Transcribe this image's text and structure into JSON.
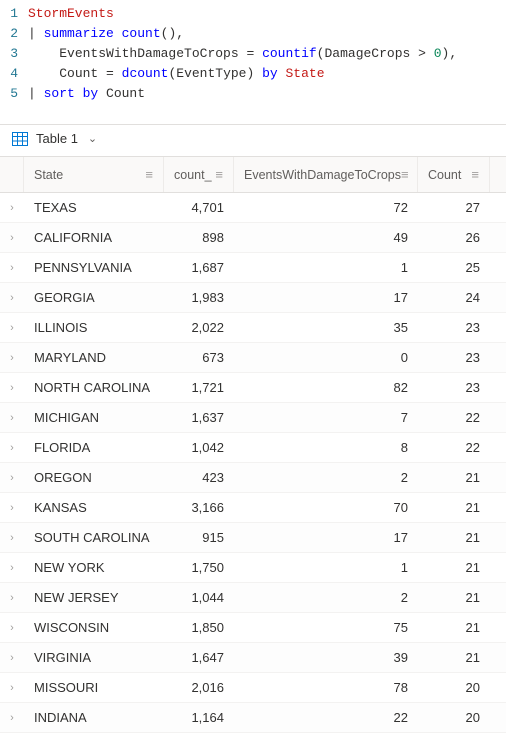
{
  "editor": {
    "lines": [
      {
        "n": 1,
        "tokens": [
          {
            "t": "StormEvents",
            "c": "tk-ident"
          }
        ]
      },
      {
        "n": 2,
        "tokens": [
          {
            "t": "| ",
            "c": "tk-punct"
          },
          {
            "t": "summarize ",
            "c": "tk-kw"
          },
          {
            "t": "count",
            "c": "tk-func"
          },
          {
            "t": "(),",
            "c": "tk-punct"
          }
        ]
      },
      {
        "n": 3,
        "tokens": [
          {
            "t": "    ",
            "c": ""
          },
          {
            "t": "EventsWithDamageToCrops",
            "c": "tk-alias"
          },
          {
            "t": " = ",
            "c": "tk-punct"
          },
          {
            "t": "countif",
            "c": "tk-func"
          },
          {
            "t": "(",
            "c": "tk-punct"
          },
          {
            "t": "DamageCrops",
            "c": "tk-col"
          },
          {
            "t": " > ",
            "c": "tk-punct"
          },
          {
            "t": "0",
            "c": "tk-num"
          },
          {
            "t": "),",
            "c": "tk-punct"
          }
        ]
      },
      {
        "n": 4,
        "tokens": [
          {
            "t": "    ",
            "c": ""
          },
          {
            "t": "Count",
            "c": "tk-alias"
          },
          {
            "t": " = ",
            "c": "tk-punct"
          },
          {
            "t": "dcount",
            "c": "tk-func"
          },
          {
            "t": "(",
            "c": "tk-punct"
          },
          {
            "t": "EventType",
            "c": "tk-col"
          },
          {
            "t": ") ",
            "c": "tk-punct"
          },
          {
            "t": "by ",
            "c": "tk-kw"
          },
          {
            "t": "State",
            "c": "tk-ident"
          }
        ]
      },
      {
        "n": 5,
        "tokens": [
          {
            "t": "| ",
            "c": "tk-punct"
          },
          {
            "t": "sort ",
            "c": "tk-kw"
          },
          {
            "t": "by ",
            "c": "tk-kw"
          },
          {
            "t": "Count",
            "c": "tk-alias"
          }
        ]
      }
    ]
  },
  "tabs": {
    "active_label": "Table 1"
  },
  "grid": {
    "headers": {
      "state": "State",
      "count_": "count_",
      "damage": "EventsWithDamageToCrops",
      "count": "Count"
    },
    "rows": [
      {
        "state": "TEXAS",
        "count_": "4,701",
        "damage": "72",
        "count": "27"
      },
      {
        "state": "CALIFORNIA",
        "count_": "898",
        "damage": "49",
        "count": "26"
      },
      {
        "state": "PENNSYLVANIA",
        "count_": "1,687",
        "damage": "1",
        "count": "25"
      },
      {
        "state": "GEORGIA",
        "count_": "1,983",
        "damage": "17",
        "count": "24"
      },
      {
        "state": "ILLINOIS",
        "count_": "2,022",
        "damage": "35",
        "count": "23"
      },
      {
        "state": "MARYLAND",
        "count_": "673",
        "damage": "0",
        "count": "23"
      },
      {
        "state": "NORTH CAROLINA",
        "count_": "1,721",
        "damage": "82",
        "count": "23"
      },
      {
        "state": "MICHIGAN",
        "count_": "1,637",
        "damage": "7",
        "count": "22"
      },
      {
        "state": "FLORIDA",
        "count_": "1,042",
        "damage": "8",
        "count": "22"
      },
      {
        "state": "OREGON",
        "count_": "423",
        "damage": "2",
        "count": "21"
      },
      {
        "state": "KANSAS",
        "count_": "3,166",
        "damage": "70",
        "count": "21"
      },
      {
        "state": "SOUTH CAROLINA",
        "count_": "915",
        "damage": "17",
        "count": "21"
      },
      {
        "state": "NEW YORK",
        "count_": "1,750",
        "damage": "1",
        "count": "21"
      },
      {
        "state": "NEW JERSEY",
        "count_": "1,044",
        "damage": "2",
        "count": "21"
      },
      {
        "state": "WISCONSIN",
        "count_": "1,850",
        "damage": "75",
        "count": "21"
      },
      {
        "state": "VIRGINIA",
        "count_": "1,647",
        "damage": "39",
        "count": "21"
      },
      {
        "state": "MISSOURI",
        "count_": "2,016",
        "damage": "78",
        "count": "20"
      },
      {
        "state": "INDIANA",
        "count_": "1,164",
        "damage": "22",
        "count": "20"
      }
    ]
  }
}
